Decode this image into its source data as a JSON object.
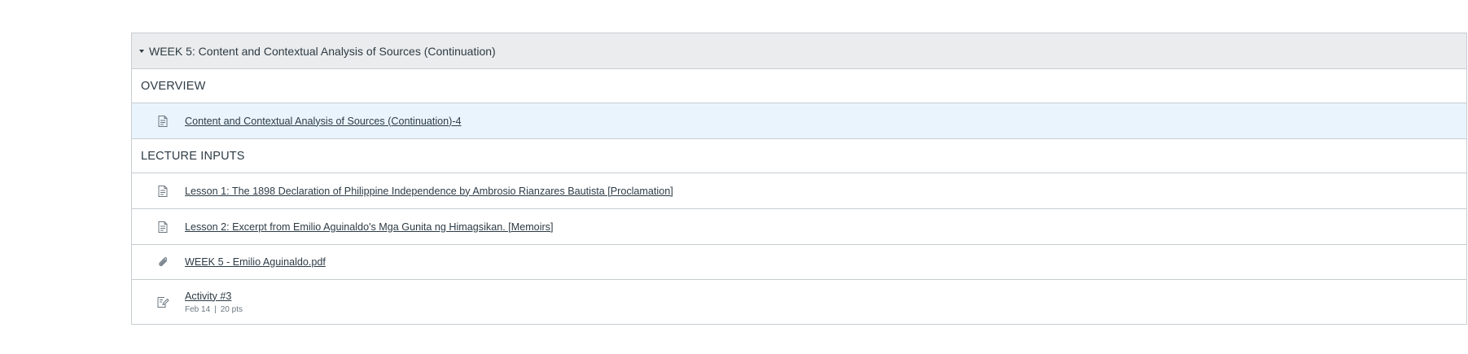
{
  "module": {
    "title": "WEEK 5: Content and Contextual Analysis of Sources (Continuation)",
    "sections": [
      {
        "header": "OVERVIEW",
        "items": [
          {
            "icon": "page-icon",
            "label": "Content and Contextual Analysis of Sources (Continuation)-4"
          }
        ]
      },
      {
        "header": "LECTURE INPUTS",
        "items": [
          {
            "icon": "page-icon",
            "label": "Lesson 1: The 1898 Declaration of Philippine Independence by Ambrosio Rianzares Bautista [Proclamation]"
          },
          {
            "icon": "page-icon",
            "label": "Lesson 2: Excerpt from Emilio Aguinaldo's Mga Gunita ng Himagsikan. [Memoirs]"
          },
          {
            "icon": "attachment-icon",
            "label": "WEEK 5 - Emilio Aguinaldo.pdf"
          },
          {
            "icon": "assignment-icon",
            "label": "Activity #3",
            "date": "Feb 14",
            "separator": "|",
            "points": "20 pts"
          }
        ]
      }
    ]
  },
  "colors": {
    "header_bg": "#ebeced",
    "highlight_bg": "#eaf4fd",
    "border": "#c7cdd1",
    "text": "#2d3b45",
    "meta_text": "#6b7780"
  }
}
